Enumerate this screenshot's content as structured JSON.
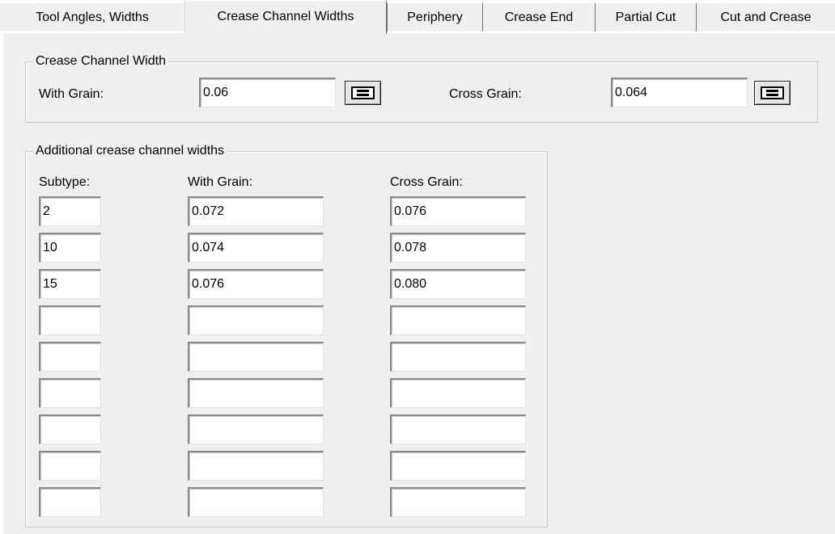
{
  "tabs": [
    {
      "label": "Tool Angles, Widths"
    },
    {
      "label": "Crease Channel Widths"
    },
    {
      "label": "Periphery"
    },
    {
      "label": "Crease End"
    },
    {
      "label": "Partial Cut"
    },
    {
      "label": "Cut and Crease"
    }
  ],
  "active_tab": "Crease Channel Widths",
  "crease_channel_width": {
    "title": "Crease Channel Width",
    "with_grain_label": "With Grain:",
    "with_grain_value": "0.06",
    "cross_grain_label": "Cross Grain:",
    "cross_grain_value": "0.064",
    "equals_button_icon": "equals-icon"
  },
  "additional": {
    "title": "Additional crease channel widths",
    "headers": {
      "subtype": "Subtype:",
      "with_grain": "With Grain:",
      "cross_grain": "Cross Grain:"
    },
    "rows": [
      {
        "subtype": "2",
        "with_grain": "0.072",
        "cross_grain": "0.076"
      },
      {
        "subtype": "10",
        "with_grain": "0.074",
        "cross_grain": "0.078"
      },
      {
        "subtype": "15",
        "with_grain": "0.076",
        "cross_grain": "0.080"
      },
      {
        "subtype": "",
        "with_grain": "",
        "cross_grain": ""
      },
      {
        "subtype": "",
        "with_grain": "",
        "cross_grain": ""
      },
      {
        "subtype": "",
        "with_grain": "",
        "cross_grain": ""
      },
      {
        "subtype": "",
        "with_grain": "",
        "cross_grain": ""
      },
      {
        "subtype": "",
        "with_grain": "",
        "cross_grain": ""
      },
      {
        "subtype": "",
        "with_grain": "",
        "cross_grain": ""
      }
    ]
  },
  "colors": {
    "dialog_background": "#f0f0f0",
    "field_background": "#ffffff",
    "group_border": "#c8c8c8"
  }
}
